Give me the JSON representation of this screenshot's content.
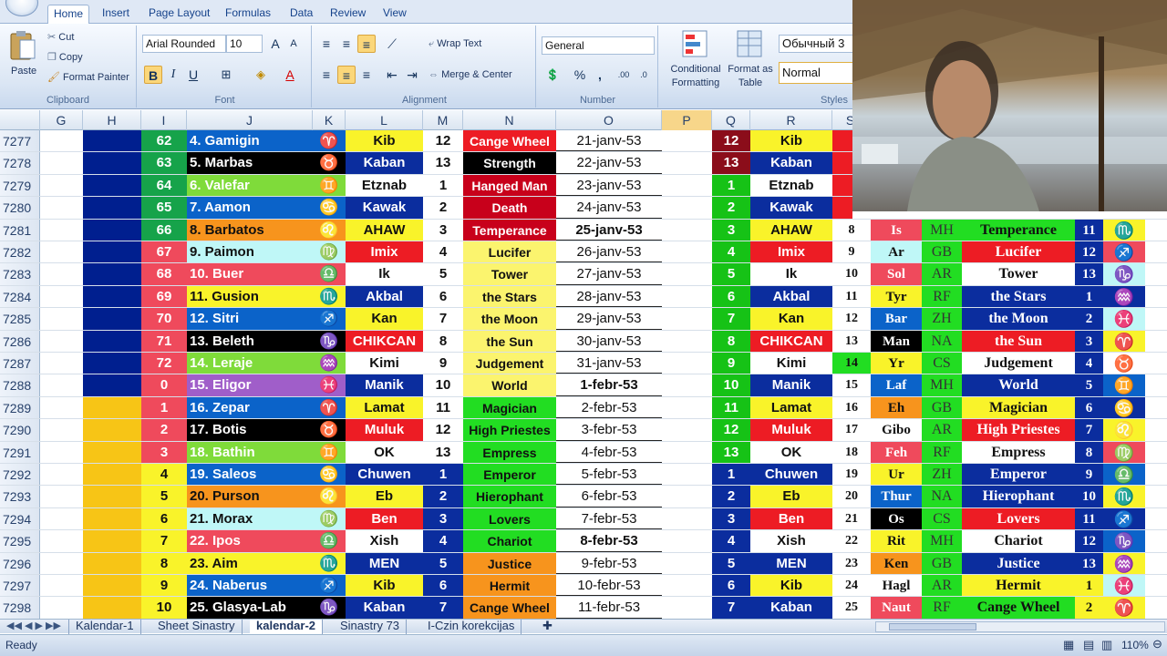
{
  "ribbon": {
    "tabs": [
      "Home",
      "Insert",
      "Page Layout",
      "Formulas",
      "Data",
      "Review",
      "View"
    ],
    "clipboard": {
      "paste": "Paste",
      "cut": "Cut",
      "copy": "Copy",
      "format_painter": "Format Painter",
      "label": "Clipboard"
    },
    "font": {
      "name": "Arial Rounded",
      "size": "10",
      "label": "Font",
      "bold": "B",
      "italic": "I",
      "underline": "U"
    },
    "alignment": {
      "wrap": "Wrap Text",
      "merge": "Merge & Center",
      "label": "Alignment"
    },
    "number": {
      "format": "General",
      "percent": "%",
      "comma": ",",
      "label": "Number"
    },
    "styles": {
      "conditional": "Conditional Formatting",
      "format_table": "Format as Table",
      "style1": "Обычный 3",
      "style2": "Normal",
      "label": "Styles"
    }
  },
  "columns": [
    "G",
    "H",
    "I",
    "J",
    "K",
    "L",
    "M",
    "N",
    "O",
    "P",
    "Q",
    "R",
    "S"
  ],
  "rows": [
    {
      "n": "7277",
      "i": "62",
      "j": "4. Gamigin",
      "k": "♈",
      "l": "Kib",
      "m": "12",
      "nn": "Cange Wheel",
      "o": "21-janv-53",
      "q": "12",
      "r": "Kib"
    },
    {
      "n": "7278",
      "i": "63",
      "j": "5. Marbas",
      "k": "♉",
      "l": "Kaban",
      "m": "13",
      "nn": "Strength",
      "o": "22-janv-53",
      "q": "13",
      "r": "Kaban"
    },
    {
      "n": "7279",
      "i": "64",
      "j": "6. Valefar",
      "k": "♊",
      "l": "Etznab",
      "m": "1",
      "nn": "Hanged Man",
      "o": "23-janv-53",
      "q": "1",
      "r": "Etznab"
    },
    {
      "n": "7280",
      "i": "65",
      "j": "7. Aamon",
      "k": "♋",
      "l": "Kawak",
      "m": "2",
      "nn": "Death",
      "o": "24-janv-53",
      "q": "2",
      "r": "Kawak"
    },
    {
      "n": "7281",
      "i": "66",
      "j": "8. Barbatos",
      "k": "♌",
      "l": "AHAW",
      "m": "3",
      "nn": "Temperance",
      "o": "25-janv-53",
      "q": "3",
      "r": "AHAW",
      "s": "8",
      "t": "Is",
      "u": "MH",
      "v": "Temperance",
      "w": "11",
      "x": "♏"
    },
    {
      "n": "7282",
      "i": "67",
      "j": "9. Paimon",
      "k": "♍",
      "l": "Imix",
      "m": "4",
      "nn": "Lucifer",
      "o": "26-janv-53",
      "q": "4",
      "r": "Imix",
      "s": "9",
      "t": "Ar",
      "u": "GB",
      "v": "Lucifer",
      "w": "12",
      "x": "♐"
    },
    {
      "n": "7283",
      "i": "68",
      "j": "10. Buer",
      "k": "♎",
      "l": "Ik",
      "m": "5",
      "nn": "Tower",
      "o": "27-janv-53",
      "q": "5",
      "r": "Ik",
      "s": "10",
      "t": "Sol",
      "u": "AR",
      "v": "Tower",
      "w": "13",
      "x": "♑"
    },
    {
      "n": "7284",
      "i": "69",
      "j": "11. Gusion",
      "k": "♏",
      "l": "Akbal",
      "m": "6",
      "nn": "the Stars",
      "o": "28-janv-53",
      "q": "6",
      "r": "Akbal",
      "s": "11",
      "t": "Tyr",
      "u": "RF",
      "v": "the Stars",
      "w": "1",
      "x": "♒"
    },
    {
      "n": "7285",
      "i": "70",
      "j": "12. Sitri",
      "k": "♐",
      "l": "Kan",
      "m": "7",
      "nn": "the Moon",
      "o": "29-janv-53",
      "q": "7",
      "r": "Kan",
      "s": "12",
      "t": "Bar",
      "u": "ZH",
      "v": "the Moon",
      "w": "2",
      "x": "♓"
    },
    {
      "n": "7286",
      "i": "71",
      "j": "13. Beleth",
      "k": "♑",
      "l": "CHIKCAN",
      "m": "8",
      "nn": "the Sun",
      "o": "30-janv-53",
      "q": "8",
      "r": "CHIKCAN",
      "s": "13",
      "t": "Man",
      "u": "NA",
      "v": "the Sun",
      "w": "3",
      "x": "♈"
    },
    {
      "n": "7287",
      "i": "72",
      "j": "14. Leraje",
      "k": "♒",
      "l": "Kimi",
      "m": "9",
      "nn": "Judgement",
      "o": "31-janv-53",
      "q": "9",
      "r": "Kimi",
      "s": "14",
      "t": "Yr",
      "u": "CS",
      "v": "Judgement",
      "w": "4",
      "x": "♉"
    },
    {
      "n": "7288",
      "i": "0",
      "j": "15. Eligor",
      "k": "♓",
      "l": "Manik",
      "m": "10",
      "nn": "World",
      "o": "1-febr-53",
      "q": "10",
      "r": "Manik",
      "s": "15",
      "t": "Laf",
      "u": "MH",
      "v": "World",
      "w": "5",
      "x": "♊"
    },
    {
      "n": "7289",
      "i": "1",
      "j": "16. Zepar",
      "k": "♈",
      "l": "Lamat",
      "m": "11",
      "nn": "Magician",
      "o": "2-febr-53",
      "q": "11",
      "r": "Lamat",
      "s": "16",
      "t": "Eh",
      "u": "GB",
      "v": "Magician",
      "w": "6",
      "x": "♋"
    },
    {
      "n": "7290",
      "i": "2",
      "j": "17. Botis",
      "k": "♉",
      "l": "Muluk",
      "m": "12",
      "nn": "High Priestes",
      "o": "3-febr-53",
      "q": "12",
      "r": "Muluk",
      "s": "17",
      "t": "Gibo",
      "u": "AR",
      "v": "High Priestes",
      "w": "7",
      "x": "♌"
    },
    {
      "n": "7291",
      "i": "3",
      "j": "18. Bathin",
      "k": "♊",
      "l": "OK",
      "m": "13",
      "nn": "Empress",
      "o": "4-febr-53",
      "q": "13",
      "r": "OK",
      "s": "18",
      "t": "Feh",
      "u": "RF",
      "v": "Empress",
      "w": "8",
      "x": "♍"
    },
    {
      "n": "7292",
      "i": "4",
      "j": "19. Saleos",
      "k": "♋",
      "l": "Chuwen",
      "m": "1",
      "nn": "Emperor",
      "o": "5-febr-53",
      "q": "1",
      "r": "Chuwen",
      "s": "19",
      "t": "Ur",
      "u": "ZH",
      "v": "Emperor",
      "w": "9",
      "x": "♎"
    },
    {
      "n": "7293",
      "i": "5",
      "j": "20. Purson",
      "k": "♌",
      "l": "Eb",
      "m": "2",
      "nn": "Hierophant",
      "o": "6-febr-53",
      "q": "2",
      "r": "Eb",
      "s": "20",
      "t": "Thur",
      "u": "NA",
      "v": "Hierophant",
      "w": "10",
      "x": "♏"
    },
    {
      "n": "7294",
      "i": "6",
      "j": "21. Morax",
      "k": "♍",
      "l": "Ben",
      "m": "3",
      "nn": "Lovers",
      "o": "7-febr-53",
      "q": "3",
      "r": "Ben",
      "s": "21",
      "t": "Os",
      "u": "CS",
      "v": "Lovers",
      "w": "11",
      "x": "♐"
    },
    {
      "n": "7295",
      "i": "7",
      "j": "22. Ipos",
      "k": "♎",
      "l": "Xish",
      "m": "4",
      "nn": "Chariot",
      "o": "8-febr-53",
      "q": "4",
      "r": "Xish",
      "s": "22",
      "t": "Rit",
      "u": "MH",
      "v": "Chariot",
      "w": "12",
      "x": "♑"
    },
    {
      "n": "7296",
      "i": "8",
      "j": "23. Aim",
      "k": "♏",
      "l": "MEN",
      "m": "5",
      "nn": "Justice",
      "o": "9-febr-53",
      "q": "5",
      "r": "MEN",
      "s": "23",
      "t": "Ken",
      "u": "GB",
      "v": "Justice",
      "w": "13",
      "x": "♒"
    },
    {
      "n": "7297",
      "i": "9",
      "j": "24. Naberus",
      "k": "♐",
      "l": "Kib",
      "m": "6",
      "nn": "Hermit",
      "o": "10-febr-53",
      "q": "6",
      "r": "Kib",
      "s": "24",
      "t": "Hagl",
      "u": "AR",
      "v": "Hermit",
      "w": "1",
      "x": "♓"
    },
    {
      "n": "7298",
      "i": "10",
      "j": "25. Glasya-Lab",
      "k": "♑",
      "l": "Kaban",
      "m": "7",
      "nn": "Cange Wheel",
      "o": "11-febr-53",
      "q": "7",
      "r": "Kaban",
      "s": "25",
      "t": "Naut",
      "u": "RF",
      "v": "Cange Wheel",
      "w": "2",
      "x": "♈"
    }
  ],
  "sheet_tabs": [
    "Kalendar-1",
    "Sheet Sinastry",
    "kalendar-2",
    "Sinastry 73",
    "I-Czin korekcijas"
  ],
  "active_sheet": "kalendar-2",
  "status": {
    "ready": "Ready",
    "zoom": "110%"
  }
}
